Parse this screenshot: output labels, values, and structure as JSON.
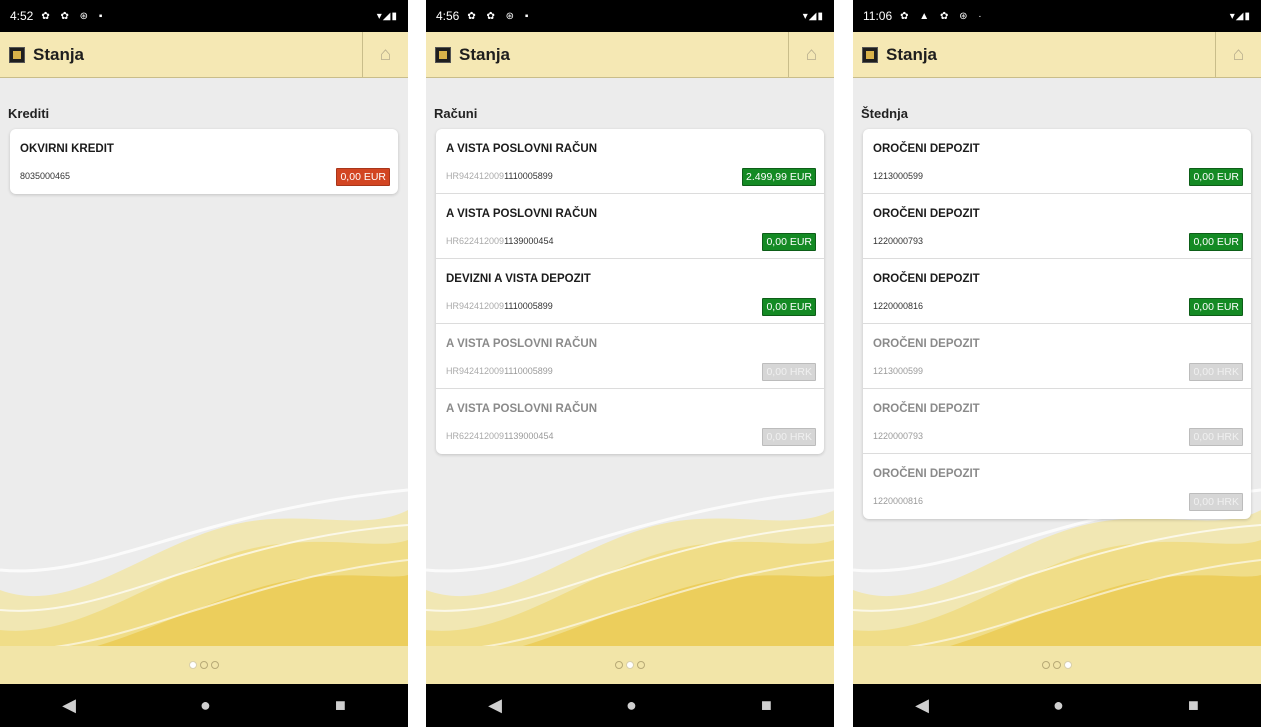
{
  "colors": {
    "header": "#f5e8b4",
    "positive": "#148a24",
    "negative": "#d24522",
    "disabled": "#d6d6d6"
  },
  "icons": {
    "home": "home-icon",
    "logo": "bank-logo-icon",
    "back": "back-triangle-icon",
    "homeNav": "home-circle-icon",
    "recents": "recents-square-icon"
  },
  "screens": [
    {
      "status_time": "4:52",
      "status_icons": "✿ ✿ ⊛ ▪",
      "status_right": "▾◢▮",
      "title": "Stanja",
      "section": "Krediti",
      "pager_active": 0,
      "accounts": [
        {
          "name": "OKVIRNI KREDIT",
          "prefix": "",
          "number": "8035000465",
          "amount": "0,00 EUR",
          "tone": "red"
        }
      ]
    },
    {
      "status_time": "4:56",
      "status_icons": "✿ ✿ ⊛ ▪",
      "status_right": "▾◢▮",
      "title": "Stanja",
      "section": "Računi",
      "pager_active": 1,
      "accounts": [
        {
          "name": "A VISTA POSLOVNI RAČUN",
          "prefix": "HR942412009",
          "number": "1110005899",
          "amount": "2.499,99 EUR",
          "tone": "green"
        },
        {
          "name": "A VISTA POSLOVNI RAČUN",
          "prefix": "HR622412009",
          "number": "1139000454",
          "amount": "0,00 EUR",
          "tone": "green"
        },
        {
          "name": "DEVIZNI A VISTA DEPOZIT",
          "prefix": "HR942412009",
          "number": "1110005899",
          "amount": "0,00 EUR",
          "tone": "green"
        },
        {
          "name": "A VISTA POSLOVNI RAČUN",
          "prefix": "HR942412009",
          "number": "1110005899",
          "amount": "0,00 HRK",
          "tone": "dim"
        },
        {
          "name": "A VISTA POSLOVNI RAČUN",
          "prefix": "HR622412009",
          "number": "1139000454",
          "amount": "0,00 HRK",
          "tone": "dim"
        }
      ]
    },
    {
      "status_time": "11:06",
      "status_icons": "✿ ▲ ✿ ⊛ ·",
      "status_right": "▾◢▮",
      "title": "Stanja",
      "section": "Štednja",
      "pager_active": 2,
      "accounts": [
        {
          "name": "OROČENI DEPOZIT",
          "prefix": "",
          "number": "1213000599",
          "amount": "0,00 EUR",
          "tone": "green"
        },
        {
          "name": "OROČENI DEPOZIT",
          "prefix": "",
          "number": "1220000793",
          "amount": "0,00 EUR",
          "tone": "green"
        },
        {
          "name": "OROČENI DEPOZIT",
          "prefix": "",
          "number": "1220000816",
          "amount": "0,00 EUR",
          "tone": "green"
        },
        {
          "name": "OROČENI DEPOZIT",
          "prefix": "",
          "number": "1213000599",
          "amount": "0,00 HRK",
          "tone": "dim"
        },
        {
          "name": "OROČENI DEPOZIT",
          "prefix": "",
          "number": "1220000793",
          "amount": "0,00 HRK",
          "tone": "dim"
        },
        {
          "name": "OROČENI DEPOZIT",
          "prefix": "",
          "number": "1220000816",
          "amount": "0,00 HRK",
          "tone": "dim"
        }
      ]
    }
  ]
}
